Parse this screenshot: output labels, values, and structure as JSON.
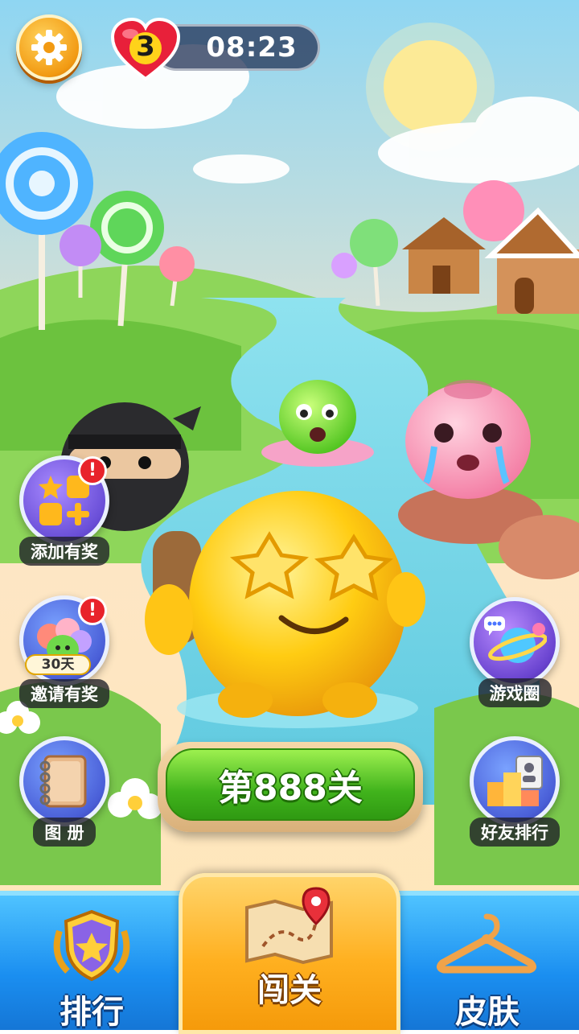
{
  "hud": {
    "lives": "3",
    "timer": "08:23",
    "settings_icon": "gear-icon",
    "heart_icon": "heart-icon"
  },
  "side_left": [
    {
      "label": "添加有奖",
      "icon": "add-shortcut-icon",
      "badge": "!"
    },
    {
      "label": "邀请有奖",
      "icon": "invite-friends-icon",
      "badge": "!",
      "tag": "30天"
    },
    {
      "label": "图 册",
      "icon": "album-book-icon"
    }
  ],
  "side_right": [
    {
      "label": "游戏圈",
      "icon": "planet-chat-icon"
    },
    {
      "label": "好友排行",
      "icon": "friends-ranking-icon"
    }
  ],
  "play": {
    "label": "第888关"
  },
  "tabs": [
    {
      "label": "排行",
      "icon": "trophy-shield-icon"
    },
    {
      "label": "闯关",
      "icon": "treasure-map-icon",
      "active": true
    },
    {
      "label": "皮肤",
      "icon": "hanger-icon"
    }
  ],
  "colors": {
    "accent_green": "#41b31c",
    "tab_blue": "#1a8ef0",
    "tab_orange": "#ffb020",
    "badge_red": "#e8232b"
  }
}
